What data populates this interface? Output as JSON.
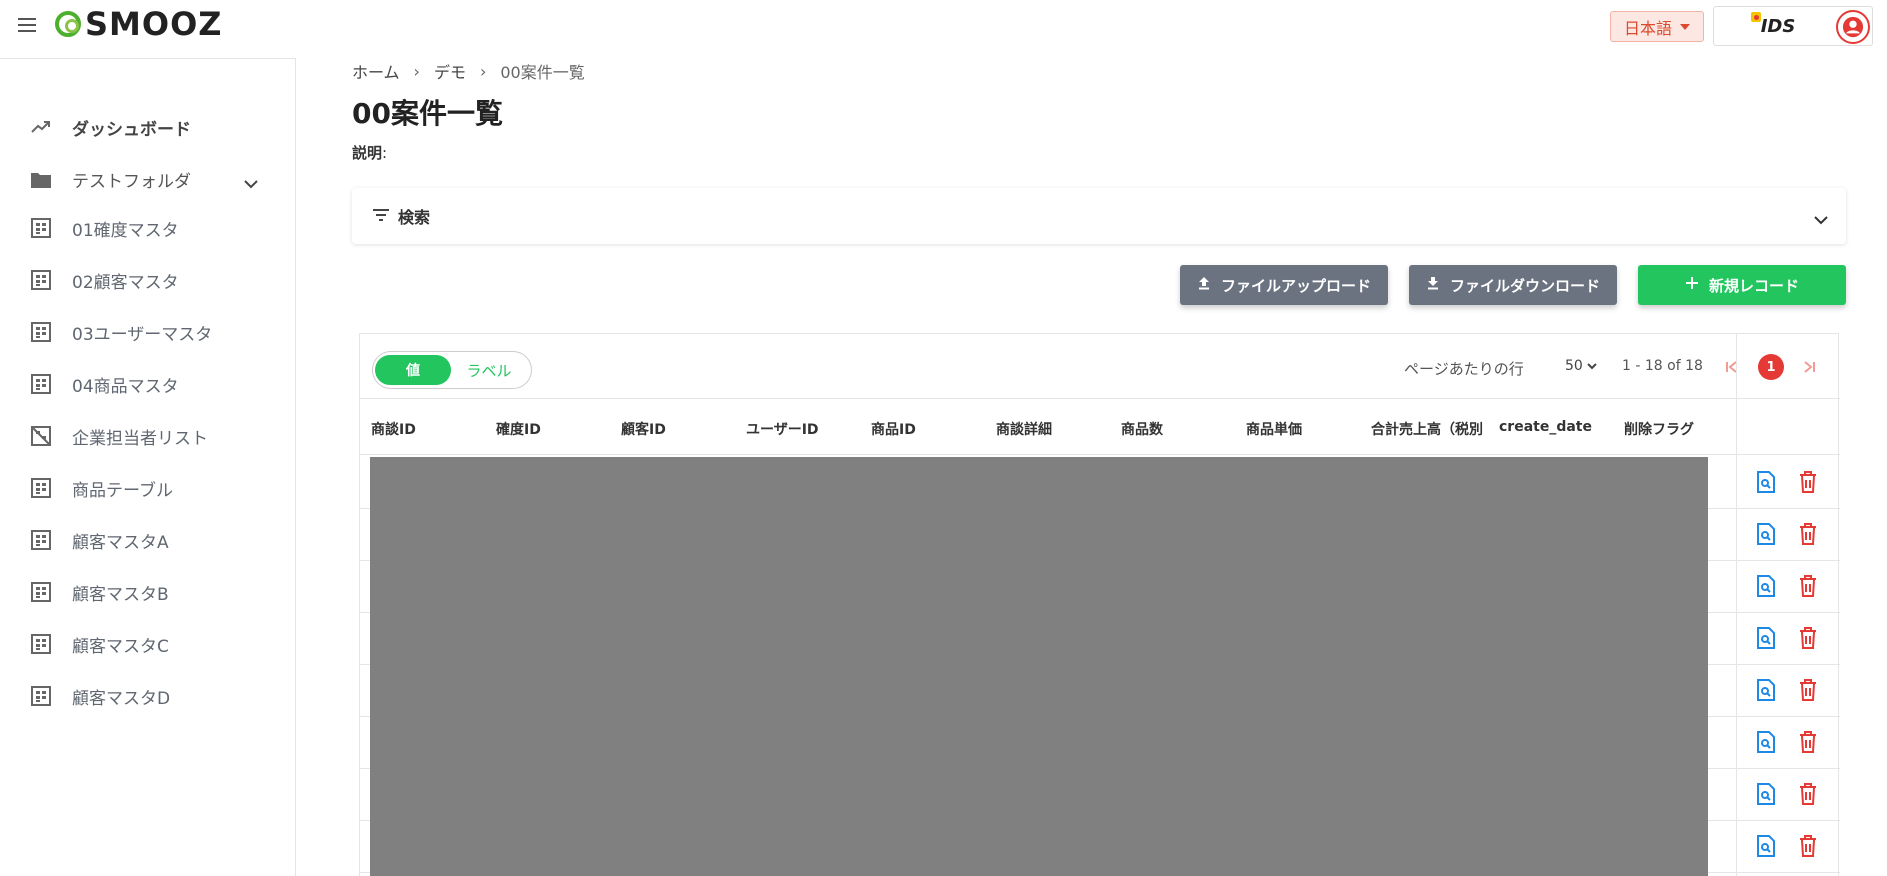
{
  "header": {
    "logo_text": "SMOOZ",
    "language": "日本語",
    "company_logo_text": "IDS"
  },
  "sidebar": {
    "items": [
      {
        "label": "ダッシュボード",
        "icon": "trending-up-icon"
      },
      {
        "label": "テストフォルダ",
        "icon": "folder-icon"
      },
      {
        "label": "01確度マスタ",
        "icon": "table-icon"
      },
      {
        "label": "02顧客マスタ",
        "icon": "table-icon"
      },
      {
        "label": "03ユーザーマスタ",
        "icon": "table-icon"
      },
      {
        "label": "04商品マスタ",
        "icon": "table-icon"
      },
      {
        "label": "企業担当者リスト",
        "icon": "table-off-icon"
      },
      {
        "label": "商品テーブル",
        "icon": "table-icon"
      },
      {
        "label": "顧客マスタA",
        "icon": "table-icon"
      },
      {
        "label": "顧客マスタB",
        "icon": "table-icon"
      },
      {
        "label": "顧客マスタC",
        "icon": "table-icon"
      },
      {
        "label": "顧客マスタD",
        "icon": "table-icon"
      }
    ]
  },
  "breadcrumb": [
    "ホーム",
    "デモ",
    "00案件一覧"
  ],
  "breadcrumb_sep": "›",
  "page": {
    "title": "00案件一覧",
    "description_label": "説明",
    "description_sep": ":"
  },
  "search": {
    "label": "検索"
  },
  "actions": {
    "upload": "ファイルアップロード",
    "download": "ファイルダウンロード",
    "new_record": "新規レコード"
  },
  "table": {
    "toggle_value": "値",
    "toggle_label": "ラベル",
    "rows_per_page_label": "ページあたりの行",
    "rows_per_page": "50",
    "range": "1 - 18 of 18",
    "current_page": "1",
    "columns": [
      "商談ID",
      "確度ID",
      "顧客ID",
      "ユーザーID",
      "商品ID",
      "商談詳細",
      "商品数",
      "商品単価",
      "合計売上高（税別",
      "create_date",
      "削除フラグ"
    ],
    "visible_rows": 8
  },
  "colors": {
    "accent_green": "#22c55e",
    "danger_red": "#e53935",
    "view_blue": "#1e88e5",
    "button_gray": "#6b7280"
  }
}
